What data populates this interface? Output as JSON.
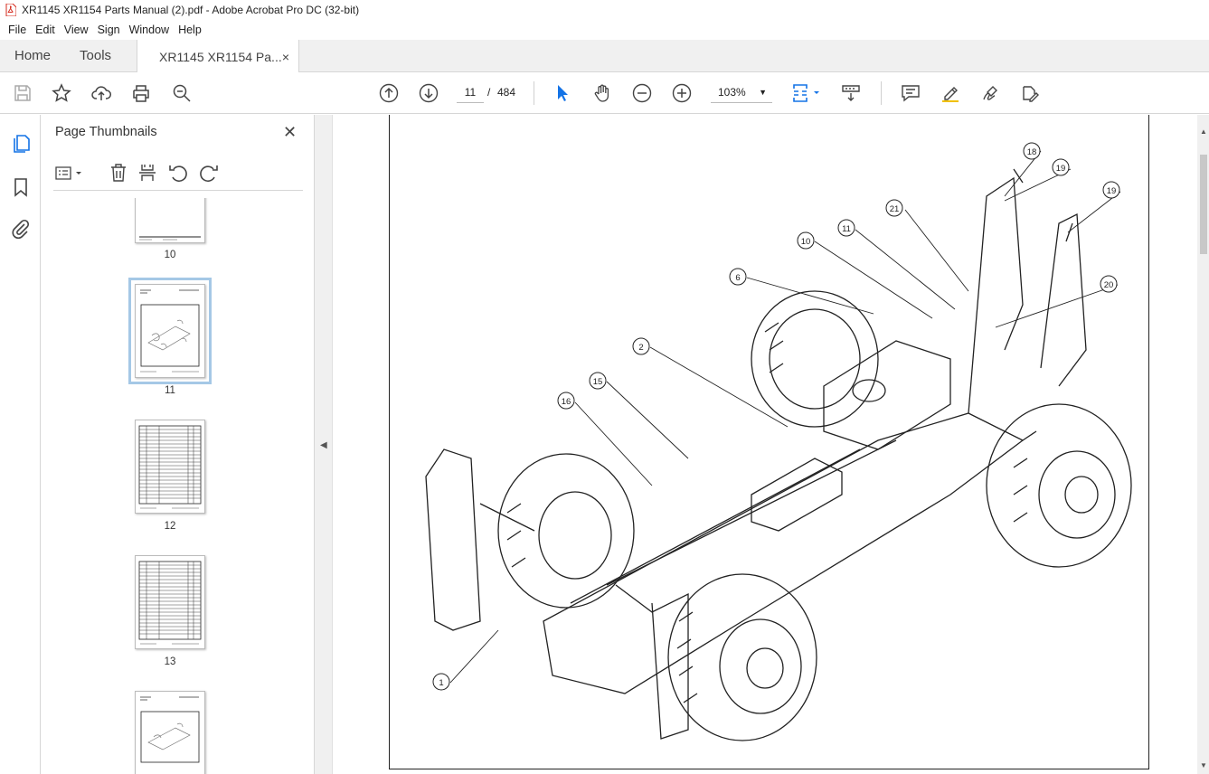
{
  "window": {
    "title": "XR1145 XR1154 Parts Manual (2).pdf - Adobe Acrobat Pro DC (32-bit)"
  },
  "menu": [
    "File",
    "Edit",
    "View",
    "Sign",
    "Window",
    "Help"
  ],
  "tabs": {
    "home": "Home",
    "tools": "Tools",
    "document": "XR1145 XR1154 Pa...",
    "close": "×"
  },
  "toolbar": {
    "page_current": "11",
    "page_sep": "/",
    "page_total": "484",
    "zoom": "103%"
  },
  "panel": {
    "title": "Page Thumbnails",
    "close": "✕",
    "thumbnails": [
      {
        "label": "10",
        "kind": "blank"
      },
      {
        "label": "11",
        "kind": "drawing",
        "selected": true
      },
      {
        "label": "12",
        "kind": "table"
      },
      {
        "label": "13",
        "kind": "table"
      },
      {
        "label": "",
        "kind": "drawing"
      }
    ]
  },
  "drawing": {
    "callouts": [
      "1",
      "2",
      "6",
      "10",
      "11",
      "15",
      "16",
      "18",
      "19",
      "19",
      "20",
      "21"
    ]
  },
  "colors": {
    "accent": "#1473e6",
    "selection": "#a5c8e6",
    "chrome": "#f0f0f0"
  }
}
